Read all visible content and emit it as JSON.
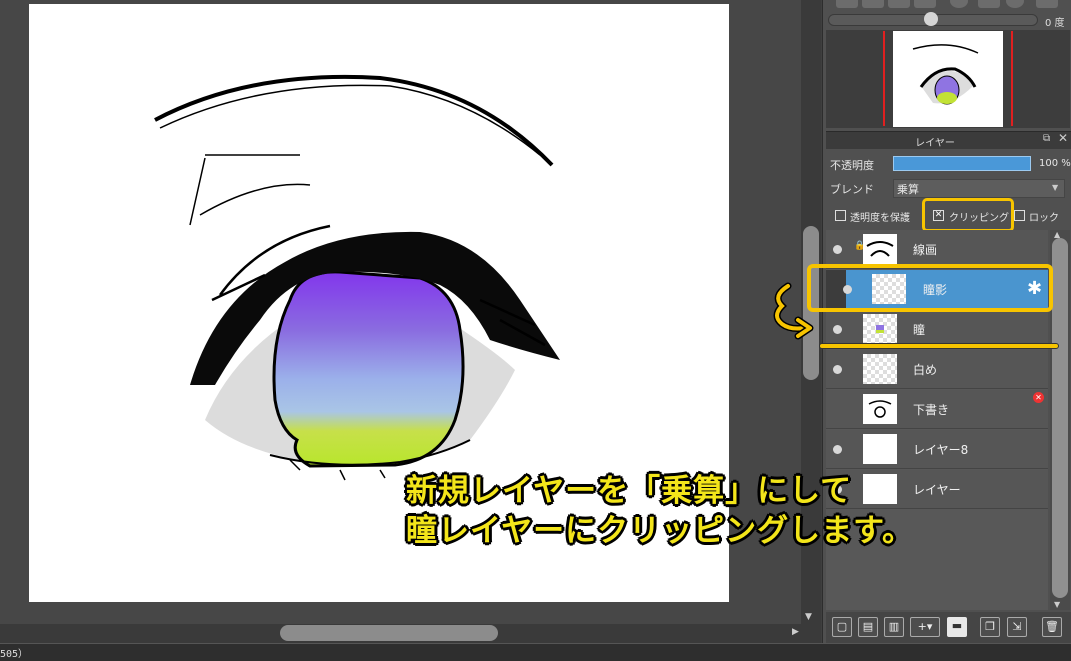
{
  "navigator": {
    "rotation_label": "0 度"
  },
  "layer_panel": {
    "title": "レイヤー",
    "opacity_label": "不透明度",
    "opacity_value": "100 %",
    "blend_label": "ブレンド",
    "blend_value": "乗算",
    "protect_alpha_label": "透明度を保護",
    "clipping_label": "クリッピング",
    "lock_label": "ロック",
    "layers": [
      {
        "name": "線画",
        "locked": true,
        "visible": true,
        "selected": false
      },
      {
        "name": "瞳影",
        "locked": false,
        "visible": true,
        "selected": true,
        "clipped": true
      },
      {
        "name": "瞳",
        "locked": false,
        "visible": true,
        "selected": false
      },
      {
        "name": "白め",
        "locked": false,
        "visible": true,
        "selected": false
      },
      {
        "name": "下書き",
        "locked": false,
        "visible": false,
        "selected": false
      },
      {
        "name": "レイヤー8",
        "locked": false,
        "visible": true,
        "selected": false
      },
      {
        "name": "レイヤー",
        "locked": false,
        "visible": true,
        "selected": false
      }
    ]
  },
  "annotation": {
    "line1": "新規レイヤーを「乗算」にして",
    "line2": "瞳レイヤーにクリッピングします。"
  },
  "statusbar": {
    "text": "505）"
  },
  "colors": {
    "highlight": "#f7c400",
    "selected_layer": "#4a95cf",
    "annotation_text": "#f3e51a"
  }
}
